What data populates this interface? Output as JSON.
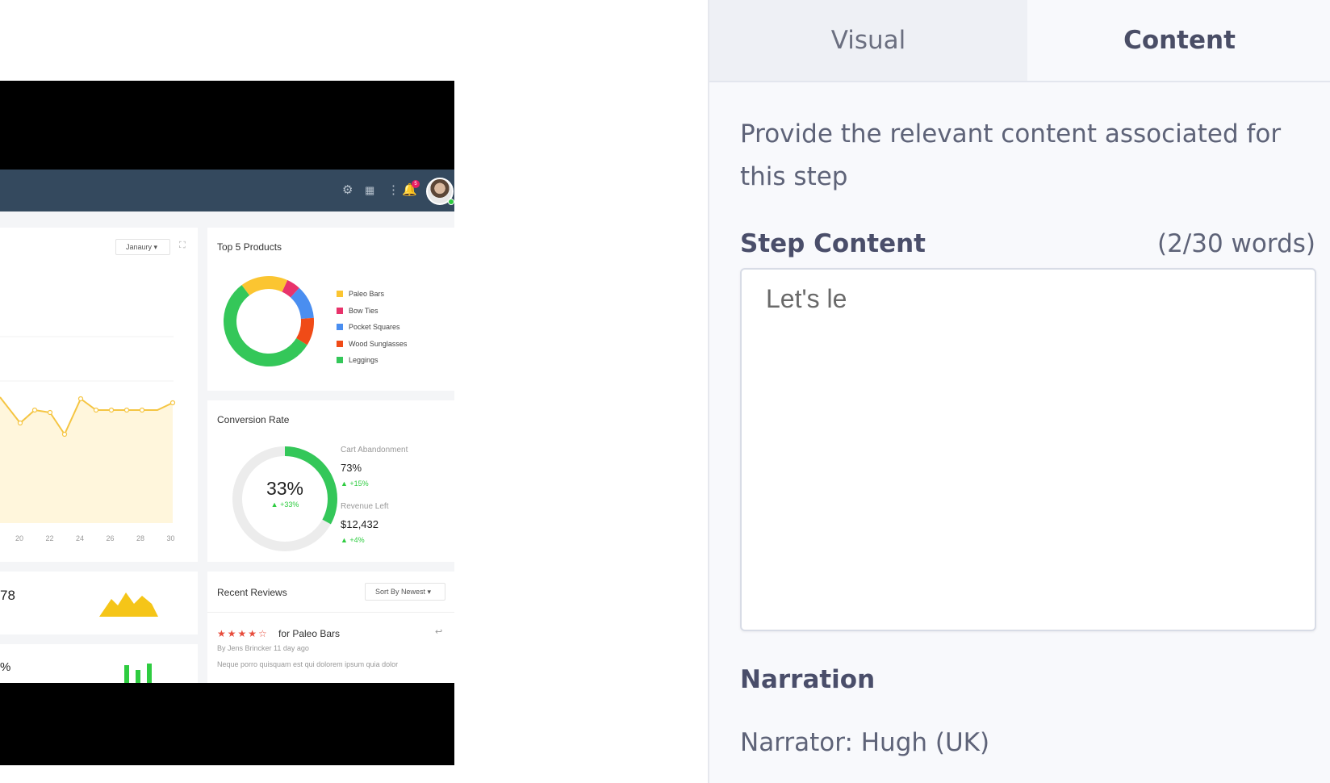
{
  "tabs": {
    "visual": "Visual",
    "content": "Content",
    "active": "content"
  },
  "content_panel": {
    "description": "Provide the relevant content associated for this step",
    "step_content_label": "Step Content",
    "word_count": "(2/30 words)",
    "step_content_value": "Let's le",
    "narration_heading": "Narration",
    "narrator": "Narrator: Hugh (UK)"
  },
  "preview": {
    "topbar": {
      "notification_count": "5",
      "icons": [
        "gear-icon",
        "grid-icon",
        "more-vertical-icon",
        "bell-icon",
        "avatar"
      ]
    },
    "sales_card": {
      "month_dropdown": "Janaury",
      "x_ticks": [
        "20",
        "22",
        "24",
        "26",
        "28",
        "30"
      ],
      "chart_data": {
        "type": "area",
        "x": [
          "20",
          "22",
          "24",
          "26",
          "28",
          "30"
        ],
        "color": "#f5c542"
      }
    },
    "top_products": {
      "title": "Top 5 Products",
      "legend": [
        "Paleo Bars",
        "Bow Ties",
        "Pocket Squares",
        "Wood Sunglasses",
        "Leggings"
      ],
      "colors": [
        "#fbc531",
        "#e8336b",
        "#4a8ef0",
        "#f04b17",
        "#34c759"
      ],
      "chart_data": {
        "type": "pie",
        "categories": [
          "Paleo Bars",
          "Bow Ties",
          "Pocket Squares",
          "Wood Sunglasses",
          "Leggings"
        ],
        "values": [
          17,
          5,
          12,
          10,
          56
        ]
      }
    },
    "conversion": {
      "title": "Conversion Rate",
      "rate": "33%",
      "rate_change": "▲ +33%",
      "cart_label": "Cart Abandonment",
      "cart_value": "73%",
      "cart_change": "▲ +15%",
      "revenue_label": "Revenue Left",
      "revenue_value": "$12,432",
      "revenue_change": "▲ +4%",
      "rate_fraction": 0.33
    },
    "reviews": {
      "title": "Recent Reviews",
      "sort": "Sort By Newest",
      "stars": "★★★★☆",
      "product": "for Paleo Bars",
      "author": "By Jens Brincker 11 day ago",
      "body": "Neque porro quisquam est qui dolorem ipsum quia dolor"
    },
    "kpi_1": "78",
    "kpi_2": "%"
  }
}
